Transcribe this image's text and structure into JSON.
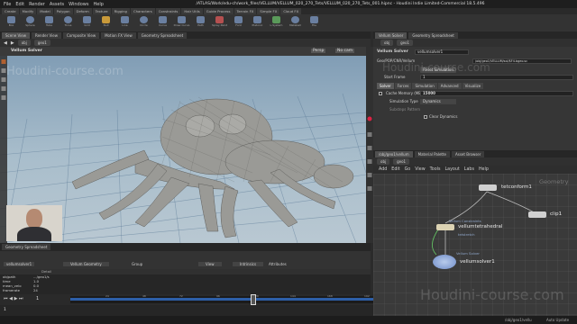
{
  "window": {
    "title": "/ATLAS/Work/edu-ch/work_files/VELLUM/VELLUM_020_270_Tets/VELLUM_020_270_Tets_001.hipnc - Houdini Indie Limited-Commercial 18.5.496",
    "menus": [
      "File",
      "Edit",
      "Render",
      "Assets",
      "Windows",
      "Help"
    ],
    "desktop": "Modeling"
  },
  "shelf": {
    "tabs": [
      "Create",
      "Modify",
      "Model",
      "Polygon",
      "Deform",
      "Texture",
      "Rigging",
      "Characters",
      "Constraints",
      "Hair Utils",
      "Guide Process",
      "Terrain FX",
      "Simple FX",
      "Cloud FX",
      "Volume"
    ],
    "tools": [
      "Box",
      "Sphere",
      "Tube",
      "Torus",
      "Grid",
      "Null",
      "Line",
      "Circle",
      "Curve",
      "Draw Curve",
      "Path",
      "Spray Paint",
      "Font",
      "Platonic",
      "L-System",
      "Metaball",
      "File"
    ]
  },
  "viewport": {
    "tabs": [
      "Scene View",
      "Render View",
      "Composite View",
      "Motion FX View",
      "Geometry Spreadsheet"
    ],
    "obj_path": "obj",
    "geo_path": "geo1",
    "label": "Vellum Solver",
    "persp": "Persp",
    "cam": "No cam",
    "watermark": "Houdini-course.com"
  },
  "spreadsheet": {
    "tabs": [
      "Geometry Spreadsheet"
    ],
    "node": "vellumsolver1",
    "view": "Vellum Geometry",
    "group": "Group",
    "filter": "View",
    "intrinsics": "Intrinsics",
    "attributes": "Attributes",
    "columns": [
      "",
      "Detail"
    ],
    "rows": [
      [
        "objpath",
        ".../geo1/s"
      ],
      [
        "time",
        "1.0"
      ],
      [
        "mean_velo",
        "0.0"
      ],
      [
        "framerate",
        "24"
      ]
    ]
  },
  "timeline": {
    "start_frame": "1",
    "end_frame": "240",
    "start_display": "1",
    "current": "88",
    "ticks": [
      "24",
      "48",
      "72",
      "96",
      "120",
      "144",
      "168",
      "192",
      "216",
      "240"
    ],
    "keys_label": "0 keys, 0/0 channels",
    "key_all": "Key All Channels",
    "end_display": "240"
  },
  "status": {
    "auto_update": "Auto Update",
    "obj_label": "/obj/geo1/vellu"
  },
  "parms": {
    "tabs": [
      "Vellum Solver",
      "Geometry Spreadsheet"
    ],
    "obj_path": "obj",
    "geo_path": "geo1",
    "node_type": "Vellum Solver",
    "node_name": "vellumsolver1",
    "reset_label": "Reset Simulation",
    "start_frame_label": "Start Frame",
    "start_frame": "1",
    "cache_label": "Cache Memory (MB)",
    "cache_value": "15000",
    "sim_type_label": "Simulation Type",
    "sim_type": "Dynamics",
    "substeps_label": "Substeps Pattern",
    "clear_dyn": "Clear Dynamics",
    "cache_path_label": "Geo/POP/CNR/Vellum",
    "cache_field": "/obj/geo1/VELLUM/sol/$F4.bgeo.sc",
    "subtabs": [
      "Solver",
      "Forces",
      "Simulation",
      "Advanced",
      "Visualize"
    ],
    "watermark": "Houdini-course.com"
  },
  "network": {
    "tabs": [
      "/obj/geo1/vellum",
      "Material Palette",
      "Asset Browser"
    ],
    "obj_path": "obj",
    "geo_path": "geo1",
    "menus": [
      "Add",
      "Edit",
      "Go",
      "View",
      "Tools",
      "Layout",
      "Labs",
      "Help"
    ],
    "context": "Geometry",
    "watermark": "Houdini-course.com",
    "nodes": [
      {
        "name": "tetconform1",
        "sub": "",
        "color": "#c9c9c9"
      },
      {
        "name": "clip1",
        "sub": "",
        "color": "#c9c9c9"
      },
      {
        "name": "vellumtetrahedral",
        "sub": "Vellum Constraints",
        "color": "#d8d0b5",
        "extra": "tetstretch"
      },
      {
        "name": "vellumsolver1",
        "sub": "Vellum Solver",
        "color": "#8fa8d8"
      }
    ]
  }
}
